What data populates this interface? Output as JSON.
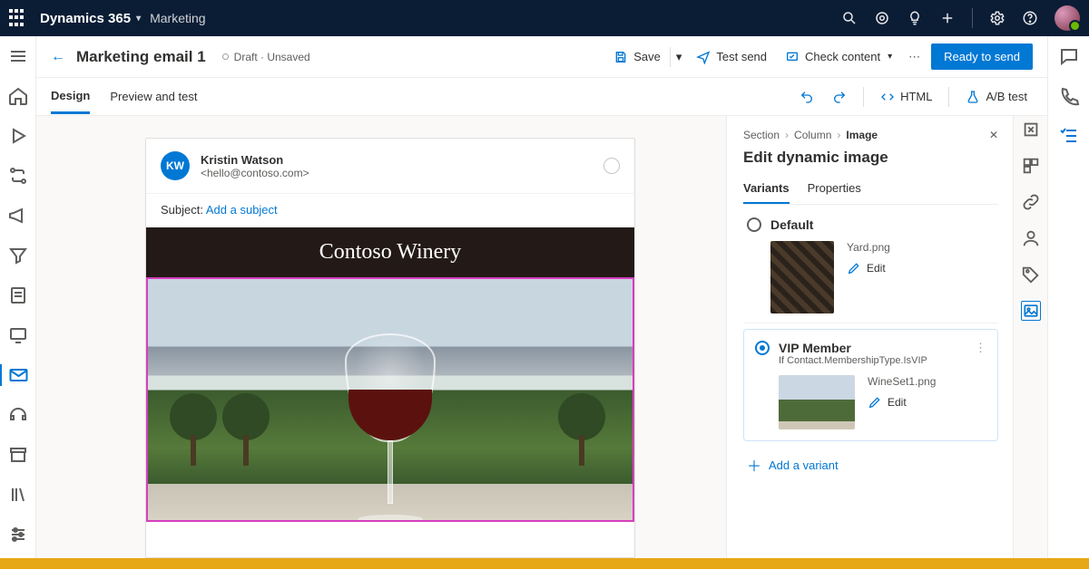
{
  "global": {
    "brand": "Dynamics 365",
    "module": "Marketing"
  },
  "page": {
    "title": "Marketing email 1",
    "status": "Draft · Unsaved"
  },
  "commands": {
    "save": "Save",
    "test_send": "Test send",
    "check_content": "Check content",
    "ready": "Ready to send",
    "html": "HTML",
    "abtest": "A/B test"
  },
  "tabs": {
    "design": "Design",
    "preview": "Preview and test"
  },
  "email": {
    "sender_initials": "KW",
    "sender_name": "Kristin Watson",
    "sender_email": "<hello@contoso.com>",
    "subject_label": "Subject: ",
    "subject_placeholder": "Add a subject",
    "banner": "Contoso Winery"
  },
  "panel": {
    "breadcrumb": {
      "a": "Section",
      "b": "Column",
      "c": "Image"
    },
    "title": "Edit dynamic image",
    "tabs": {
      "variants": "Variants",
      "properties": "Properties"
    },
    "variants": [
      {
        "name": "Default",
        "file": "Yard.png",
        "edit": "Edit",
        "selected": false
      },
      {
        "name": "VIP Member",
        "condition": "If Contact.MembershipType.IsVIP",
        "file": "WineSet1.png",
        "edit": "Edit",
        "selected": true
      }
    ],
    "add": "Add a variant"
  }
}
